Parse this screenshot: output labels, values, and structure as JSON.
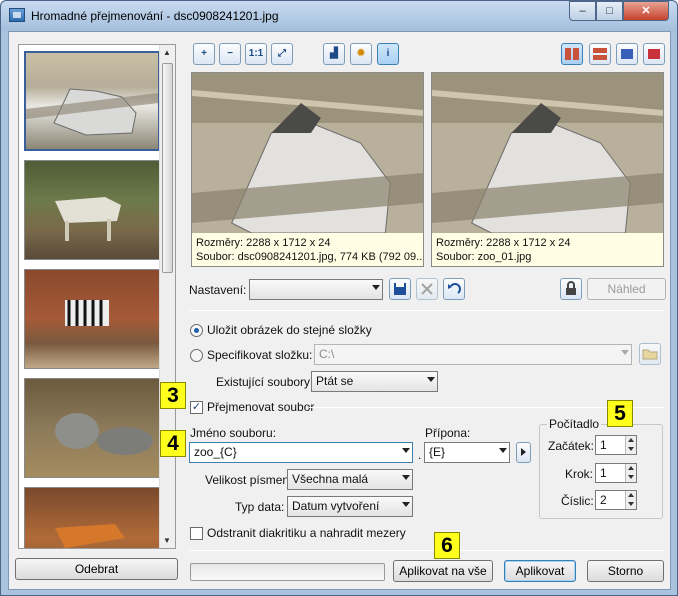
{
  "window": {
    "title": "Hromadné přejmenování - dsc0908241201.jpg",
    "min": "‒",
    "max": "□",
    "close": "✕"
  },
  "sidebar": {
    "remove_button": "Odebrat"
  },
  "toolbar": {
    "zoom_in": "+",
    "zoom_out": "−",
    "actual_size": "1:1",
    "fit": "⤢",
    "histogram": "▟",
    "effects": "✹",
    "info": "i"
  },
  "preview_left": {
    "dimensions": "Rozměry: 2288 x 1712 x 24",
    "file": "Soubor: dsc0908241201.jpg, 774 KB (792 09..."
  },
  "preview_right": {
    "dimensions": "Rozměry: 2288 x 1712 x 24",
    "file": "Soubor: zoo_01.jpg"
  },
  "settings": {
    "label": "Nastavení:",
    "value": "",
    "preview_button": "Náhled"
  },
  "save_location": {
    "same_folder": "Uložit obrázek do stejné složky",
    "specify_folder": "Specifikovat složku:",
    "folder_value": "C:\\",
    "existing_label": "Existující soubory:",
    "existing_value": "Ptát se"
  },
  "rename": {
    "checkbox": "Přejmenovat soubor",
    "name_label": "Jméno souboru:",
    "name_value": "zoo_{C}",
    "ext_label": "Přípona:",
    "ext_value": "{E}",
    "dot": ".",
    "case_label": "Velikost písmen:",
    "case_value": "Všechna malá",
    "date_label": "Typ data:",
    "date_value": "Datum vytvoření",
    "remove_diacritics": "Odstranit diakritiku a nahradit mezery"
  },
  "counter": {
    "title": "Počítadlo",
    "start_label": "Začátek:",
    "start_value": "1",
    "step_label": "Krok:",
    "step_value": "1",
    "digits_label": "Číslic:",
    "digits_value": "2"
  },
  "markers": {
    "m3": "3",
    "m4": "4",
    "m5": "5",
    "m6": "6"
  },
  "footer": {
    "apply_all": "Aplikovat na vše",
    "apply": "Aplikovat",
    "cancel": "Storno"
  },
  "colors": {
    "title_bar": "#a4bfdc",
    "preview_bg": "#fffde3",
    "marker": "#ffff1e",
    "accent": "#1f5fae"
  }
}
